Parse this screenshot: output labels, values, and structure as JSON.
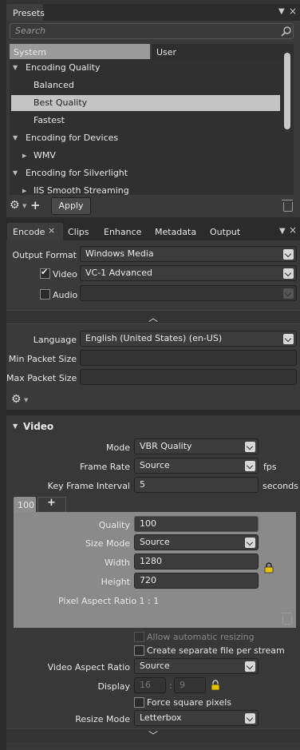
{
  "presets": {
    "title": "Presets",
    "search_placeholder": "Search",
    "tabs": [
      "System",
      "User"
    ],
    "tree": [
      {
        "label": "Encoding Quality",
        "level": 0,
        "expanded": true
      },
      {
        "label": "Balanced",
        "level": 1
      },
      {
        "label": "Best Quality",
        "level": 1,
        "selected": true
      },
      {
        "label": "Fastest",
        "level": 1
      },
      {
        "label": "Encoding for Devices",
        "level": 0,
        "expanded": true
      },
      {
        "label": "WMV",
        "level": 1,
        "collapsed": true
      },
      {
        "label": "Encoding for Silverlight",
        "level": 0,
        "expanded": true
      },
      {
        "label": "IIS Smooth Streaming",
        "level": 1,
        "collapsed": true
      }
    ],
    "apply_label": "Apply"
  },
  "encode": {
    "tabs": [
      "Encode",
      "Clips",
      "Enhance",
      "Metadata",
      "Output"
    ],
    "close_glyph": "×",
    "output_format_label": "Output Format",
    "output_format_value": "Windows Media",
    "video_label": "Video",
    "video_codec": "VC-1 Advanced",
    "audio_label": "Audio",
    "language_label": "Language",
    "language_value": "English (United States) (en-US)",
    "min_packet_label": "Min Packet Size",
    "max_packet_label": "Max Packet Size"
  },
  "video": {
    "section_title": "Video",
    "mode_label": "Mode",
    "mode_value": "VBR Quality",
    "frame_rate_label": "Frame Rate",
    "frame_rate_value": "Source",
    "fps_unit": "fps",
    "key_frame_label": "Key Frame Interval",
    "key_frame_value": "5",
    "seconds_unit": "seconds",
    "stream_tab": "100",
    "add_tab": "+",
    "quality_label": "Quality",
    "quality_value": "100",
    "size_mode_label": "Size Mode",
    "size_mode_value": "Source",
    "width_label": "Width",
    "width_value": "1280",
    "height_label": "Height",
    "height_value": "720",
    "pixel_aspect": "Pixel Aspect Ratio 1 : 1",
    "allow_resize": "Allow automatic resizing",
    "separate_file": "Create separate file per stream",
    "video_aspect_label": "Video Aspect Ratio",
    "video_aspect_value": "Source",
    "display_label": "Display",
    "display_w": "16",
    "display_sep": ":",
    "display_h": "9",
    "force_square": "Force square pixels",
    "resize_mode_label": "Resize Mode",
    "resize_mode_value": "Letterbox"
  }
}
